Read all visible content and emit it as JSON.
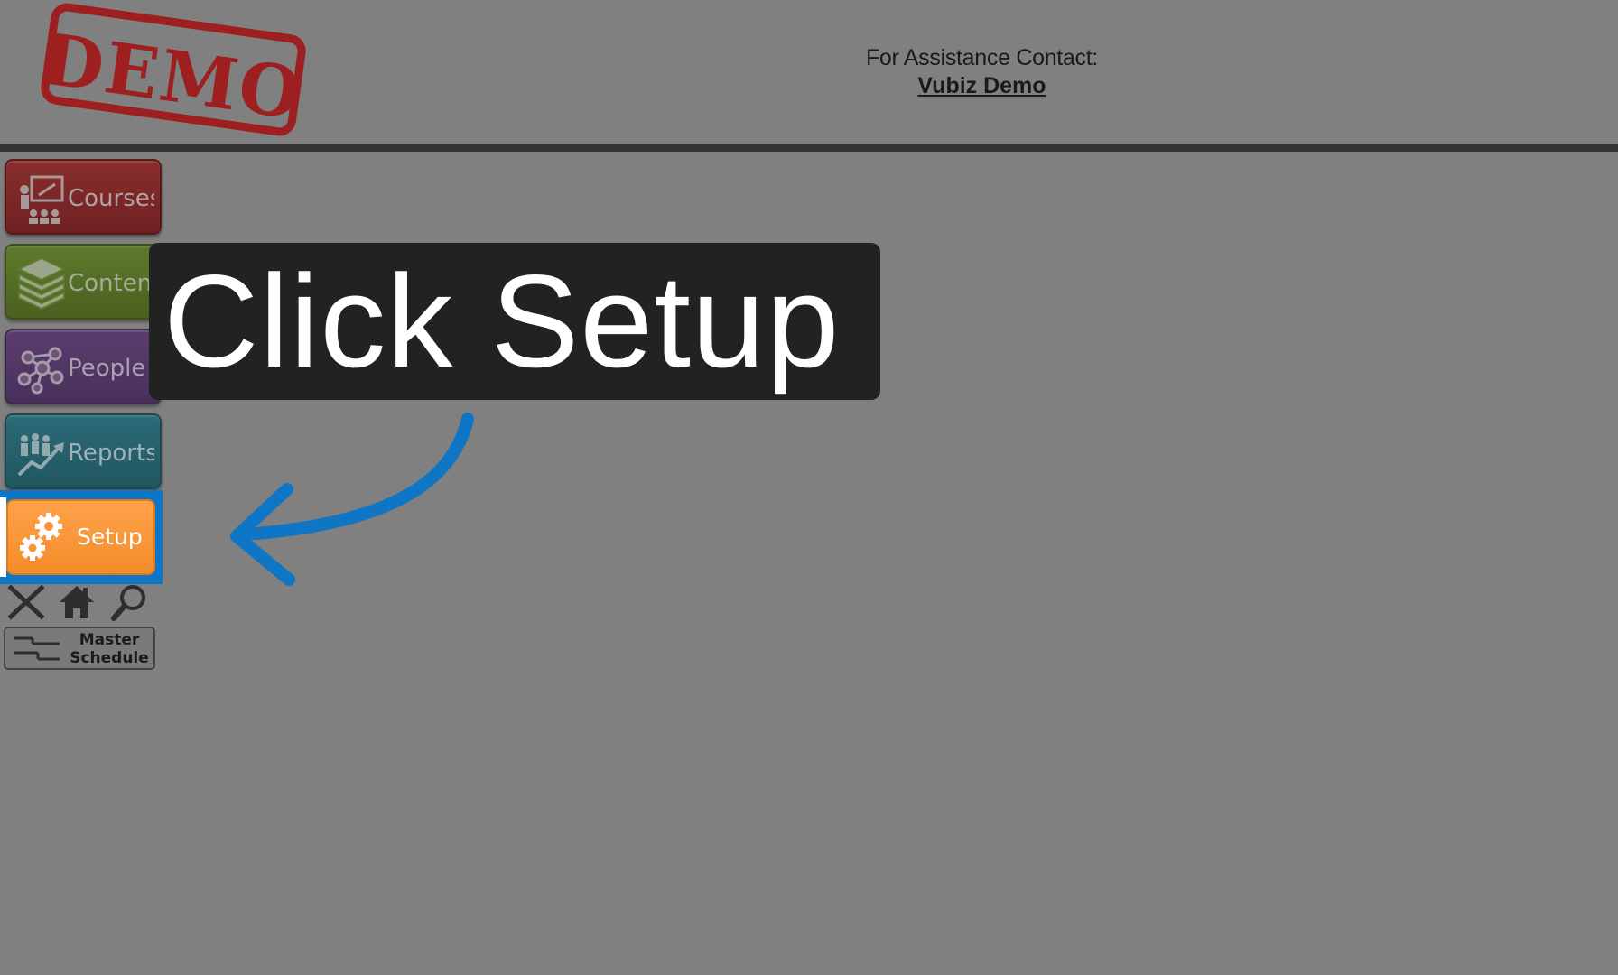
{
  "header": {
    "assist_label": "For Assistance Contact:",
    "assist_link": "Vubiz Demo",
    "logo": "DEMO"
  },
  "nav": {
    "items": [
      {
        "label": "Courses",
        "icon": "presentation-icon",
        "color": "#7c2828"
      },
      {
        "label": "Content",
        "icon": "stack-icon",
        "color": "#556e26"
      },
      {
        "label": "People",
        "icon": "network-icon",
        "color": "#523664"
      },
      {
        "label": "Reports",
        "icon": "chart-people-icon",
        "color": "#26616c"
      },
      {
        "label": "Setup",
        "icon": "gears-icon",
        "color": "#f7963a"
      }
    ]
  },
  "toolbar": {
    "close": "close-icon",
    "home": "home-icon",
    "search": "search-icon"
  },
  "master_schedule": {
    "line1": "Master",
    "line2": "Schedule"
  },
  "tooltip": {
    "text": "Click Setup"
  },
  "colors": {
    "highlight": "#0e76c4",
    "background": "#808080",
    "divider": "#333333"
  }
}
